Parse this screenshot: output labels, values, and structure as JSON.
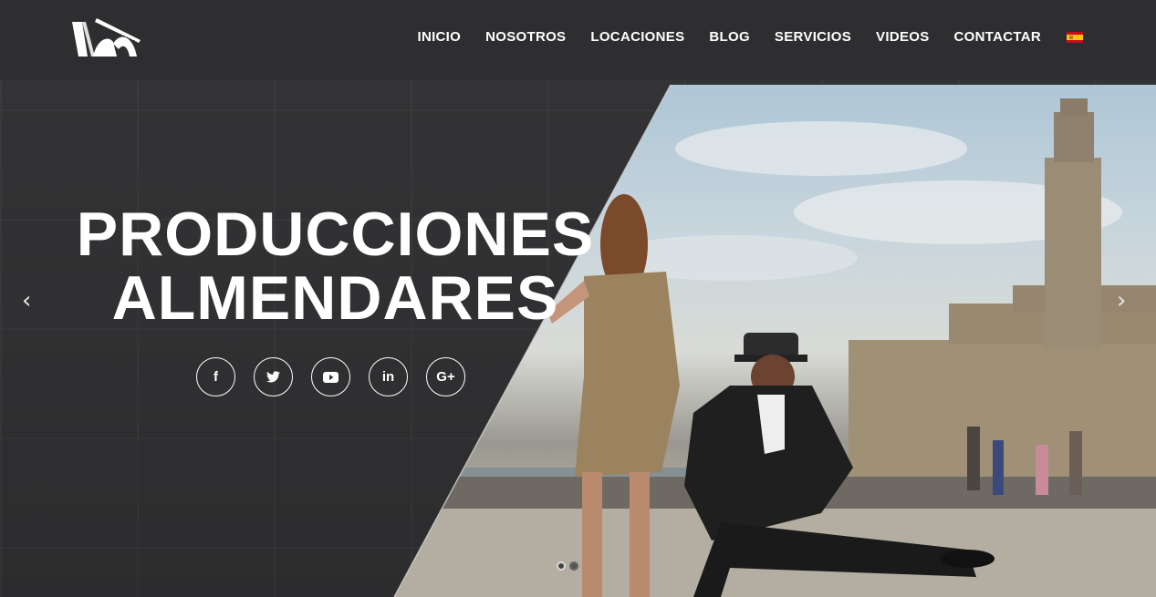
{
  "header": {
    "logo_icon": "film-strip-arch-logo",
    "nav": [
      {
        "label": "INICIO"
      },
      {
        "label": "NOSOTROS"
      },
      {
        "label": "LOCACIONES"
      },
      {
        "label": "BLOG"
      },
      {
        "label": "SERVICIOS"
      },
      {
        "label": "VIDEOS"
      },
      {
        "label": "CONTACTAR"
      }
    ],
    "language_flag": "spain-flag-icon"
  },
  "hero": {
    "title_line1": "PRODUCCIONES",
    "title_line2": "ALMENDARES",
    "social": [
      {
        "icon": "facebook-icon",
        "glyph": "f"
      },
      {
        "icon": "twitter-icon",
        "glyph": "❖"
      },
      {
        "icon": "youtube-icon",
        "glyph": "▶"
      },
      {
        "icon": "linkedin-icon",
        "glyph": "in"
      },
      {
        "icon": "google-plus-icon",
        "glyph": "G+"
      }
    ],
    "prev_arrow": "‹",
    "next_arrow": "›",
    "slide_count": 2,
    "active_slide": 1
  },
  "colors": {
    "header_bg": "#2e2e30",
    "text": "#ffffff"
  }
}
